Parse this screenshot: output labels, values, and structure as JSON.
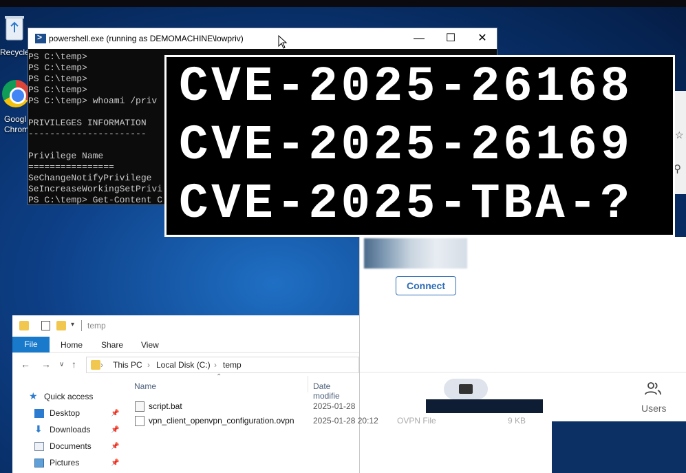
{
  "desktop": {
    "recycle_label": "Recycle",
    "chrome_label_1": "Googl",
    "chrome_label_2": "Chrom"
  },
  "powershell": {
    "title": "powershell.exe (running as DEMOMACHINE\\lowpriv)",
    "lines": [
      "PS C:\\temp>",
      "PS C:\\temp>",
      "PS C:\\temp>",
      "PS C:\\temp>",
      "PS C:\\temp> whoami /priv",
      "",
      "PRIVILEGES INFORMATION",
      "----------------------",
      "",
      "Privilege Name",
      "================",
      "SeChangeNotifyPrivilege",
      "SeIncreaseWorkingSetPrivi",
      "PS C:\\temp> Get-Content C"
    ]
  },
  "overlay": {
    "line1": "CVE-2025-26168",
    "line2": "CVE-2025-26169",
    "line3": "CVE-2025-TBA-?"
  },
  "vpn": {
    "connect_label": "Connect",
    "users_label": "Users"
  },
  "explorer": {
    "title": "temp",
    "ribbon_tabs": [
      "File",
      "Home",
      "Share",
      "View"
    ],
    "breadcrumb": [
      "This PC",
      "Local Disk (C:)",
      "temp"
    ],
    "sidebar": [
      {
        "label": "Quick access",
        "icon": "star-icon"
      },
      {
        "label": "Desktop",
        "icon": "desktop-icon"
      },
      {
        "label": "Downloads",
        "icon": "download-icon"
      },
      {
        "label": "Documents",
        "icon": "documents-icon"
      },
      {
        "label": "Pictures",
        "icon": "pictures-icon"
      }
    ],
    "columns": {
      "name": "Name",
      "date": "Date modifie"
    },
    "files": [
      {
        "name": "script.bat",
        "date": "2025-01-28"
      },
      {
        "name": "vpn_client_openvpn_configuration.ovpn",
        "date": "2025-01-28 20:12"
      }
    ],
    "ghost_type": "OVPN File",
    "ghost_size": "9 KB"
  },
  "colors": {
    "accent": "#1979ca",
    "connect": "#2d6bb4",
    "terminal_bg": "#0c0c0c"
  }
}
